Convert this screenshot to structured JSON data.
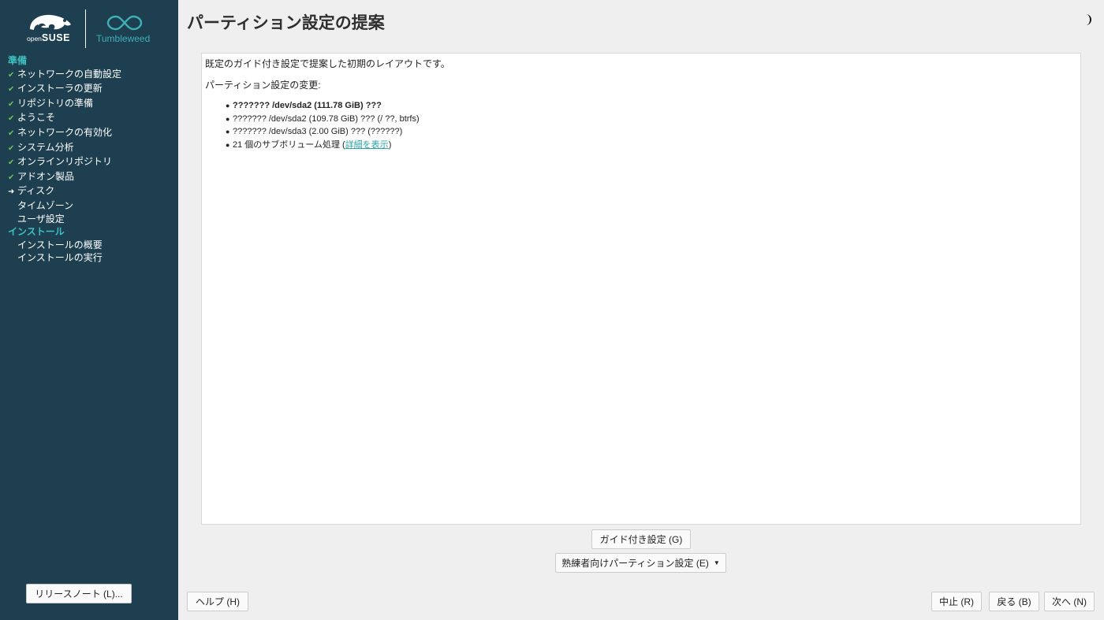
{
  "sidebar": {
    "logo": {
      "brand_prefix": "open",
      "brand_name": "SUSE",
      "product": "Tumbleweed"
    },
    "steps": [
      {
        "label": "準備",
        "type": "section"
      },
      {
        "label": "ネットワークの自動設定",
        "type": "step",
        "status": "done"
      },
      {
        "label": "インストーラの更新",
        "type": "step",
        "status": "done"
      },
      {
        "label": "リポジトリの準備",
        "type": "step",
        "status": "done"
      },
      {
        "label": "ようこそ",
        "type": "step",
        "status": "done"
      },
      {
        "label": "ネットワークの有効化",
        "type": "step",
        "status": "done"
      },
      {
        "label": "システム分析",
        "type": "step",
        "status": "done"
      },
      {
        "label": "オンラインリポジトリ",
        "type": "step",
        "status": "done"
      },
      {
        "label": "アドオン製品",
        "type": "step",
        "status": "done"
      },
      {
        "label": "ディスク",
        "type": "step",
        "status": "current"
      },
      {
        "label": "タイムゾーン",
        "type": "step",
        "status": "pending"
      },
      {
        "label": "ユーザ設定",
        "type": "step",
        "status": "pending"
      },
      {
        "label": "インストール",
        "type": "section"
      },
      {
        "label": "インストールの概要",
        "type": "step",
        "status": "pending"
      },
      {
        "label": "インストールの実行",
        "type": "step",
        "status": "pending"
      }
    ],
    "release_notes_label": "リリースノート (L)..."
  },
  "main": {
    "title": "パーティション設定の提案",
    "theme_icon": "half-moon-icon",
    "intro": "既定のガイド付き設定で提案した初期のレイアウトです。",
    "changes_heading": "パーティション設定の変更:",
    "changes": [
      {
        "text": "??????? /dev/sda2 (111.78 GiB) ???",
        "bold": true
      },
      {
        "text": "??????? /dev/sda2 (109.78 GiB) ??? (/ ??, btrfs)",
        "bold": false
      },
      {
        "text": "??????? /dev/sda3 (2.00 GiB) ??? (??????)",
        "bold": false
      },
      {
        "text": "21 個のサブボリューム処理 (",
        "link": "詳細を表示",
        "suffix": ")",
        "bold": false
      }
    ],
    "guided_button": "ガイド付き設定 (G)",
    "expert_button": "熟練者向けパーティション設定 (E)"
  },
  "footer": {
    "help": "ヘルプ (H)",
    "abort": "中止 (R)",
    "back": "戻る (B)",
    "next": "次へ (N)"
  },
  "colors": {
    "sidebar_bg": "#1d3f4f",
    "section_accent": "#3fc0c3",
    "check_green": "#6fc25a",
    "link": "#2aa3a7"
  }
}
